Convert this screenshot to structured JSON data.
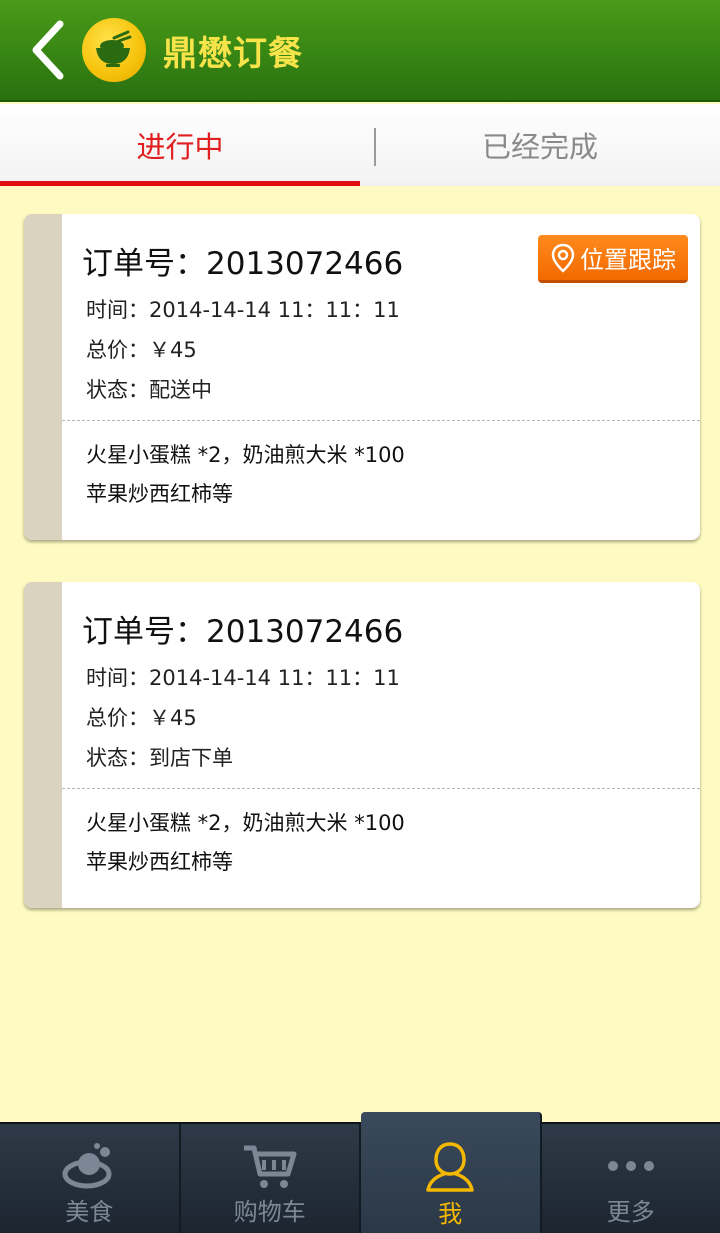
{
  "header": {
    "title": "鼎懋订餐",
    "back_icon": "chevron-left-icon",
    "logo_icon": "rice-bowl-icon"
  },
  "tabs": [
    {
      "label": "进行中",
      "active": true
    },
    {
      "label": "已经完成",
      "active": false
    }
  ],
  "orders": [
    {
      "order_no": "订单号：2013072466",
      "time": "时间：2014-14-14 11：11：11",
      "price": "总价：￥45",
      "status": "状态：配送中",
      "items_line1": "火星小蛋糕 *2，奶油煎大米 *100",
      "items_line2": "苹果炒西红柿等",
      "track_label": "位置跟踪"
    },
    {
      "order_no": "订单号：2013072466",
      "time": "时间：2014-14-14 11：11：11",
      "price": "总价：￥45",
      "status": "状态：到店下单",
      "items_line1": "火星小蛋糕 *2，奶油煎大米 *100",
      "items_line2": "苹果炒西红柿等"
    }
  ],
  "bottom_nav": [
    {
      "label": "美食",
      "icon": "food-icon",
      "active": false
    },
    {
      "label": "购物车",
      "icon": "cart-icon",
      "active": false
    },
    {
      "label": "我",
      "icon": "user-icon",
      "active": true
    },
    {
      "label": "更多",
      "icon": "more-icon",
      "active": false
    }
  ],
  "colors": {
    "header_green": "#3a8a14",
    "title_yellow": "#f7e34a",
    "active_tab_red": "#e02020",
    "track_orange": "#f26a00",
    "page_bg": "#fefbc2",
    "nav_active": "#f5b800"
  }
}
